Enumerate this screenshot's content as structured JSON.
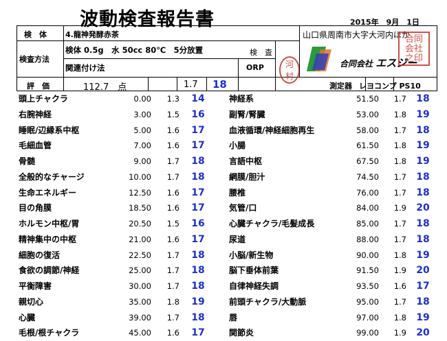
{
  "report": {
    "title": "波動検査報告書",
    "date": "2015年　9月　1日",
    "labels": {
      "specimen": "検　体",
      "method": "検査方法",
      "evaluation": "評　価",
      "inspector": "検　査",
      "orp": "ORP",
      "device_label": "測定器"
    },
    "specimen": "4.龍神発酵赤茶",
    "method_line1": "検体 0.5g　水 50cc  80℃　5分放置",
    "method_line2": "関連付け法",
    "eval_score": "112.7　点",
    "eval_value": "1.7",
    "eval_grade": "18",
    "address": "山口県周南市大字大河内ほか",
    "company_prefix": "合同会社",
    "company_name": "エスジー",
    "device": "レヨコンプ PS10",
    "stamp_inspector": "河村",
    "stamp_company": "合同会社印"
  },
  "colors": {
    "score": "#1c2fd0",
    "stamp": "#c8302a"
  },
  "left_rows": [
    {
      "name": "頭上チャクラ",
      "code": "0.00",
      "value": "1.3",
      "score": "14"
    },
    {
      "name": "右腕神経",
      "code": "3.00",
      "value": "1.5",
      "score": "16"
    },
    {
      "name": "睡眠/辺縁系中枢",
      "code": "5.00",
      "value": "1.6",
      "score": "17"
    },
    {
      "name": "毛細血管",
      "code": "7.00",
      "value": "1.6",
      "score": "17"
    },
    {
      "name": "骨髄",
      "code": "9.00",
      "value": "1.7",
      "score": "18"
    },
    {
      "name": "全般的なチャージ",
      "code": "10.00",
      "value": "1.7",
      "score": "18"
    },
    {
      "name": "生命エネルギー",
      "code": "12.50",
      "value": "1.6",
      "score": "17"
    },
    {
      "name": "目の角膜",
      "code": "18.50",
      "value": "1.6",
      "score": "17"
    },
    {
      "name": "ホルモン中枢/胃",
      "code": "20.50",
      "value": "1.5",
      "score": "16"
    },
    {
      "name": "精神集中の中枢",
      "code": "21.00",
      "value": "1.6",
      "score": "17"
    },
    {
      "name": "細胞の復活",
      "code": "22.50",
      "value": "1.7",
      "score": "18"
    },
    {
      "name": "食欲の調節/神経",
      "code": "25.00",
      "value": "1.7",
      "score": "18"
    },
    {
      "name": "平衡障害",
      "code": "30.00",
      "value": "1.7",
      "score": "18"
    },
    {
      "name": "親切心",
      "code": "35.00",
      "value": "1.8",
      "score": "19"
    },
    {
      "name": "心臓",
      "code": "39.00",
      "value": "1.7",
      "score": "18"
    },
    {
      "name": "毛根/根チャクラ",
      "code": "45.00",
      "value": "1.6",
      "score": "17"
    }
  ],
  "right_rows": [
    {
      "name": "神経系",
      "code": "51.50",
      "value": "1.7",
      "score": "18"
    },
    {
      "name": "副腎/腎臓",
      "code": "53.00",
      "value": "1.8",
      "score": "19"
    },
    {
      "name": "血液循環/神経細胞再生",
      "code": "58.00",
      "value": "1.7",
      "score": "18"
    },
    {
      "name": "小腸",
      "code": "61.50",
      "value": "1.8",
      "score": "19"
    },
    {
      "name": "言語中枢",
      "code": "67.50",
      "value": "1.8",
      "score": "19"
    },
    {
      "name": "網膜/胆汁",
      "code": "74.50",
      "value": "1.7",
      "score": "18"
    },
    {
      "name": "腰椎",
      "code": "76.00",
      "value": "1.7",
      "score": "18"
    },
    {
      "name": "気管/口",
      "code": "84.00",
      "value": "1.9",
      "score": "20"
    },
    {
      "name": "心臓チャクラ/毛髪成長",
      "code": "85.00",
      "value": "1.7",
      "score": "18"
    },
    {
      "name": "尿道",
      "code": "88.00",
      "value": "1.7",
      "score": "18"
    },
    {
      "name": "小脳/新生物",
      "code": "90.00",
      "value": "1.8",
      "score": "19"
    },
    {
      "name": "脳下垂体前葉",
      "code": "91.50",
      "value": "1.9",
      "score": "20"
    },
    {
      "name": "自律神経失調",
      "code": "93.50",
      "value": "1.6",
      "score": "17"
    },
    {
      "name": "前頭チャクラ/大動脈",
      "code": "95.00",
      "value": "1.7",
      "score": "18"
    },
    {
      "name": "唇",
      "code": "97.00",
      "value": "1.8",
      "score": "19"
    },
    {
      "name": "関節炎",
      "code": "99.00",
      "value": "1.9",
      "score": "20"
    }
  ]
}
